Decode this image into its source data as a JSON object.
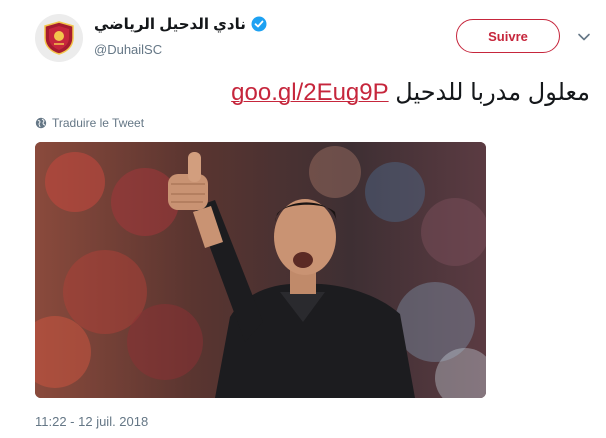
{
  "profile": {
    "display_name": "نادي الدحيل الرياضي",
    "handle": "@DuhailSC",
    "verified": true,
    "avatar_icon": "club-crest-logo",
    "brand_color": "#c6263c"
  },
  "actions": {
    "follow_label": "Suivre",
    "menu_icon": "chevron-down-icon"
  },
  "tweet": {
    "text": "معلول مدربا للدحيل",
    "link": "goo.gl/2Eug9P",
    "translate_label": "Traduire le Tweet",
    "translate_icon": "globe-icon",
    "media_description_icon": "photo",
    "timestamp": "11:22 - 12 juil. 2018"
  }
}
